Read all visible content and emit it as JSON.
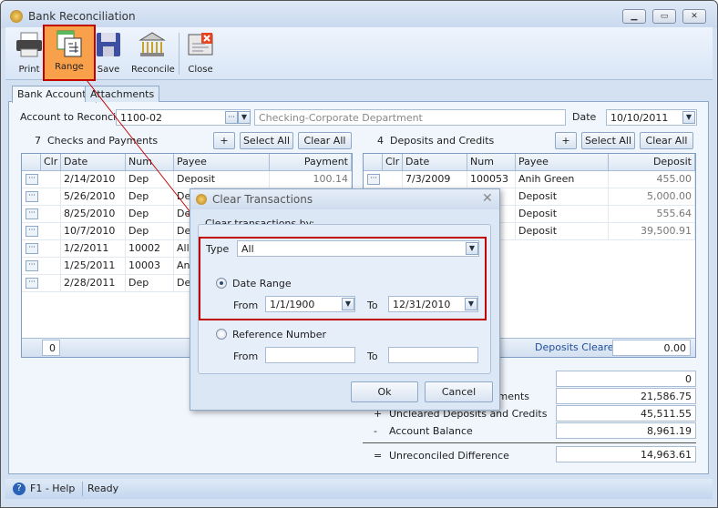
{
  "window": {
    "title": "Bank Reconciliation",
    "controls": [
      "minimize",
      "restore",
      "close"
    ]
  },
  "toolbar": {
    "items": [
      {
        "label": "Print",
        "icon": "printer-icon"
      },
      {
        "label": "Range",
        "icon": "range-icon",
        "highlighted": true
      },
      {
        "label": "Save",
        "icon": "floppy-disk-icon"
      },
      {
        "label": "Reconcile",
        "icon": "bank-icon"
      },
      {
        "label": "Close",
        "icon": "close-window-icon"
      }
    ]
  },
  "tabs": [
    {
      "label": "Bank Accounts",
      "active": true
    },
    {
      "label": "Attachments"
    }
  ],
  "account": {
    "label": "Account to Reconcile",
    "value": "1100-02",
    "description": "Checking-Corporate Department",
    "date_label": "Date",
    "date": "10/10/2011"
  },
  "checks": {
    "count": "7",
    "title": "Checks and Payments",
    "add": "+",
    "select_all": "Select All",
    "clear_all": "Clear All",
    "columns": [
      "",
      "Clr",
      "Date",
      "Num",
      "Payee",
      "Payment"
    ],
    "rows": [
      {
        "date": "2/14/2010",
        "num": "Dep",
        "payee": "Deposit",
        "amount": "100.14"
      },
      {
        "date": "5/26/2010",
        "num": "Dep",
        "payee": "De",
        "amount": ""
      },
      {
        "date": "8/25/2010",
        "num": "Dep",
        "payee": "De",
        "amount": ""
      },
      {
        "date": "10/7/2010",
        "num": "Dep",
        "payee": "De",
        "amount": ""
      },
      {
        "date": "1/2/2011",
        "num": "10002",
        "payee": "Alle",
        "amount": ""
      },
      {
        "date": "1/25/2011",
        "num": "10003",
        "payee": "An",
        "amount": ""
      },
      {
        "date": "2/28/2011",
        "num": "Dep",
        "payee": "De",
        "amount": ""
      }
    ],
    "footer_count": "0"
  },
  "deposits": {
    "count": "4",
    "title": "Deposits and Credits",
    "add": "+",
    "select_all": "Select All",
    "clear_all": "Clear All",
    "columns": [
      "",
      "Clr",
      "Date",
      "Num",
      "Payee",
      "Deposit"
    ],
    "rows": [
      {
        "date": "7/3/2009",
        "num": "100053",
        "payee": "Anih Green",
        "amount": "455.00"
      },
      {
        "date": "",
        "num": "",
        "payee": "Deposit",
        "amount": "5,000.00"
      },
      {
        "date": "",
        "num": "",
        "payee": "Deposit",
        "amount": "555.64"
      },
      {
        "date": "",
        "num": "",
        "payee": "Deposit",
        "amount": "39,500.91"
      }
    ],
    "footer_label": "Deposits Cleared",
    "footer_value": "0.00"
  },
  "summary": {
    "rows": [
      {
        "sign": "",
        "label": ":",
        "value": "0"
      },
      {
        "sign": "",
        "label": "yments",
        "value": "21,586.75"
      },
      {
        "sign": "+",
        "label": "Uncleared Deposits and Credits",
        "value": "45,511.55"
      },
      {
        "sign": "-",
        "label": "Account Balance",
        "value": "8,961.19"
      }
    ],
    "total": {
      "sign": "=",
      "label": "Unreconciled Difference",
      "value": "14,963.61"
    }
  },
  "status": {
    "help": "F1 - Help",
    "text": "Ready"
  },
  "dialog": {
    "title": "Clear Transactions",
    "group": "Clear transactions by:",
    "type_label": "Type",
    "type_value": "All",
    "date_range": {
      "label": "Date Range",
      "selected": true,
      "from_label": "From",
      "from": "1/1/1900",
      "to_label": "To",
      "to": "12/31/2010"
    },
    "reference": {
      "label": "Reference Number",
      "selected": false,
      "from_label": "From",
      "from": "",
      "to_label": "To",
      "to": ""
    },
    "ok": "Ok",
    "cancel": "Cancel"
  },
  "colors": {
    "highlight": "#c00000",
    "range_button": "#f9a04a",
    "accent": "#2a5aa8"
  }
}
